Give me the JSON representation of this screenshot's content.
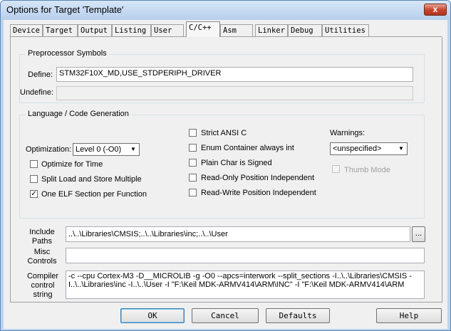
{
  "window": {
    "title": "Options for Target 'Template'",
    "close_glyph": "x"
  },
  "tabs": [
    {
      "label": "Device"
    },
    {
      "label": "Target"
    },
    {
      "label": "Output"
    },
    {
      "label": "Listing"
    },
    {
      "label": "User"
    },
    {
      "label": "C/C++"
    },
    {
      "label": "Asm"
    },
    {
      "label": "Linker"
    },
    {
      "label": "Debug"
    },
    {
      "label": "Utilities"
    }
  ],
  "active_tab": "C/C++",
  "preprocessor": {
    "title": "Preprocessor Symbols",
    "define_label": "Define:",
    "define_value": "STM32F10X_MD,USE_STDPERIPH_DRIVER",
    "undefine_label": "Undefine:",
    "undefine_value": ""
  },
  "language": {
    "title": "Language / Code Generation",
    "optimization_label": "Optimization:",
    "optimization_value": "Level 0 (-O0)",
    "optimize_time": {
      "label": "Optimize for Time",
      "checked": false
    },
    "split_load": {
      "label": "Split Load and Store Multiple",
      "checked": false
    },
    "one_elf": {
      "label": "One ELF Section per Function",
      "checked": true
    },
    "strict_ansi": {
      "label": "Strict ANSI C",
      "checked": false
    },
    "enum_container": {
      "label": "Enum Container always int",
      "checked": false
    },
    "plain_char": {
      "label": "Plain Char is Signed",
      "checked": false
    },
    "ropi": {
      "label": "Read-Only Position Independent",
      "checked": false
    },
    "rwpi": {
      "label": "Read-Write Position Independent",
      "checked": false
    },
    "warnings_label": "Warnings:",
    "warnings_value": "<unspecified>",
    "thumb_mode": {
      "label": "Thumb Mode",
      "checked": false,
      "enabled": false
    }
  },
  "include": {
    "label": "Include Paths",
    "value": "..\\..\\Libraries\\CMSIS;..\\..\\Libraries\\inc;..\\..\\User",
    "browse_label": "..."
  },
  "misc": {
    "label": "Misc Controls",
    "value": ""
  },
  "compiler": {
    "label": "Compiler control string",
    "value": "-c --cpu Cortex-M3 -D__MICROLIB -g -O0 --apcs=interwork --split_sections -I..\\..\\Libraries\\CMSIS -I..\\..\\Libraries\\inc -I..\\..\\User -I \"F:\\Keil MDK-ARMV414\\ARM\\INC\" -I \"F:\\Keil MDK-ARMV414\\ARM"
  },
  "buttons": {
    "ok": "OK",
    "cancel": "Cancel",
    "defaults": "Defaults",
    "help": "Help"
  }
}
